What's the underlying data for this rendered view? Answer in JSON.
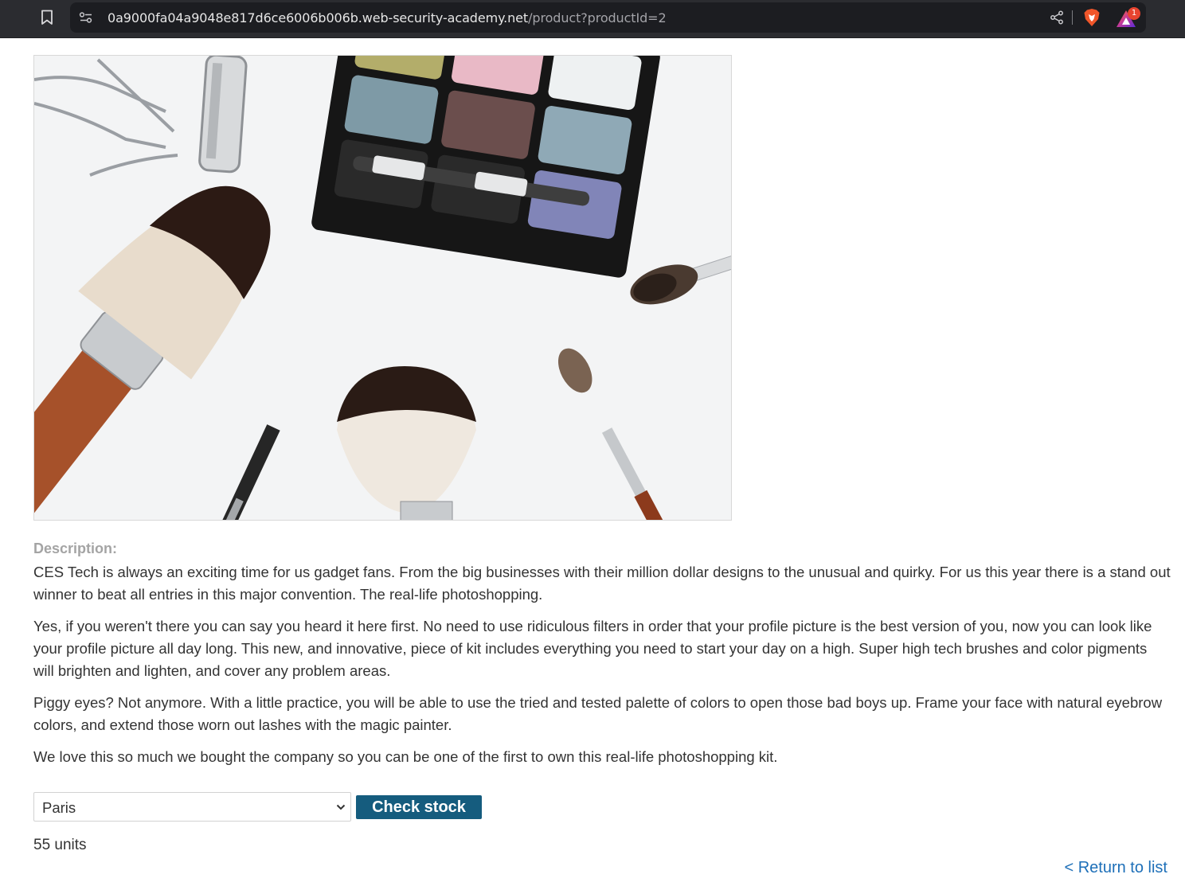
{
  "browser": {
    "url_host": "0a9000fa04a9048e817d6ce6006b006b.web-security-academy.net",
    "url_path": "/product?productId=2",
    "rewards_count": "1",
    "icons": [
      "bookmark-icon",
      "site-info-icon",
      "share-icon",
      "brave-shield-icon",
      "brave-rewards-icon"
    ]
  },
  "product": {
    "description_label": "Description:",
    "paragraphs": [
      "CES Tech is always an exciting time for us gadget fans. From the big businesses with their million dollar designs to the unusual and quirky. For us this year there is a stand out winner to beat all entries in this major convention. The real-life photoshopping.",
      "Yes, if you weren't there you can say you heard it here first. No need to use ridiculous filters in order that your profile picture is the best version of you, now you can look like your profile picture all day long. This new, and innovative, piece of kit includes everything you need to start your day on a high. Super high tech brushes and color pigments will brighten and lighten, and cover any problem areas.",
      "Piggy eyes? Not anymore. With a little practice, you will be able to use the tried and tested palette of colors to open those bad boys up. Frame your face with natural eyebrow colors, and extend those worn out lashes with the magic painter.",
      "We love this so much we bought the company so you can be one of the first to own this real-life photoshopping kit."
    ]
  },
  "stock": {
    "selected_store": "Paris",
    "check_button_label": "Check stock",
    "result": "55 units"
  },
  "navigation": {
    "return_link": "< Return to list"
  },
  "colors": {
    "button_bg": "#155c7e",
    "link": "#1d6fb8",
    "label": "#a4a4a4",
    "text": "#333333"
  }
}
